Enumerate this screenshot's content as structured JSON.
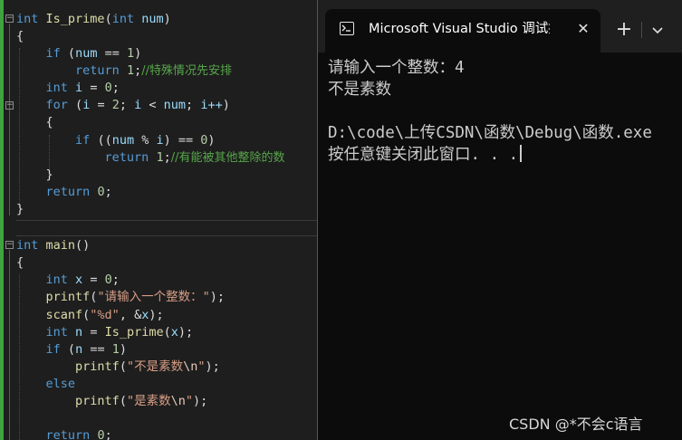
{
  "editor": {
    "fn1_type": "int",
    "fn1_name": "Is_prime",
    "fn1_param_type": "int",
    "fn1_param": "num",
    "if1_kw": "if",
    "if1_var": "num",
    "if1_op": " == ",
    "if1_num": "1",
    "ret1_kw": "return",
    "ret1_num": "1",
    "ret1_comment": "//特殊情况先安排",
    "decl_i_type": "int",
    "decl_i_var": "i",
    "decl_i_num": "0",
    "for_kw": "for",
    "for_init_var": "i",
    "for_init_num": "2",
    "for_cond_var": "i",
    "for_cond_op": " < ",
    "for_cond_bound": "num",
    "for_inc": "i++",
    "if2_kw": "if",
    "if2_var1": "num",
    "if2_op": " % ",
    "if2_var2": "i",
    "if2_cmp": " == ",
    "if2_num": "0",
    "ret2_kw": "return",
    "ret2_num": "1",
    "ret2_comment": "//有能被其他整除的数",
    "ret3_kw": "return",
    "ret3_num": "0",
    "main_type": "int",
    "main_name": "main",
    "decl_x_type": "int",
    "decl_x_var": "x",
    "decl_x_num": "0",
    "printf1_fn": "printf",
    "printf1_str": "\"请输入一个整数：\"",
    "scanf_fn": "scanf",
    "scanf_str": "\"%d\"",
    "scanf_arg": "x",
    "decl_n_type": "int",
    "decl_n_var": "n",
    "decl_n_call": "Is_prime",
    "decl_n_arg": "x",
    "if3_kw": "if",
    "if3_var": "n",
    "if3_num": "1",
    "printf2_fn": "printf",
    "printf2_str": "\"不是素数",
    "printf2_esc": "\\n",
    "printf2_end": "\"",
    "else_kw": "else",
    "printf3_fn": "printf",
    "printf3_str": "\"是素数",
    "printf3_esc": "\\n",
    "printf3_end": "\"",
    "ret4_kw": "return",
    "ret4_num": "0"
  },
  "console": {
    "tab_title": "Microsoft Visual Studio 调试控制台",
    "close_glyph": "✕",
    "new_tab_glyph": "+",
    "lines": [
      "请输入一个整数：4",
      "不是素数",
      "",
      "D:\\code\\上传CSDN\\函数\\Debug\\函数.exe",
      "按任意键关闭此窗口. . ."
    ]
  },
  "watermark": "CSDN @*不会c语言"
}
